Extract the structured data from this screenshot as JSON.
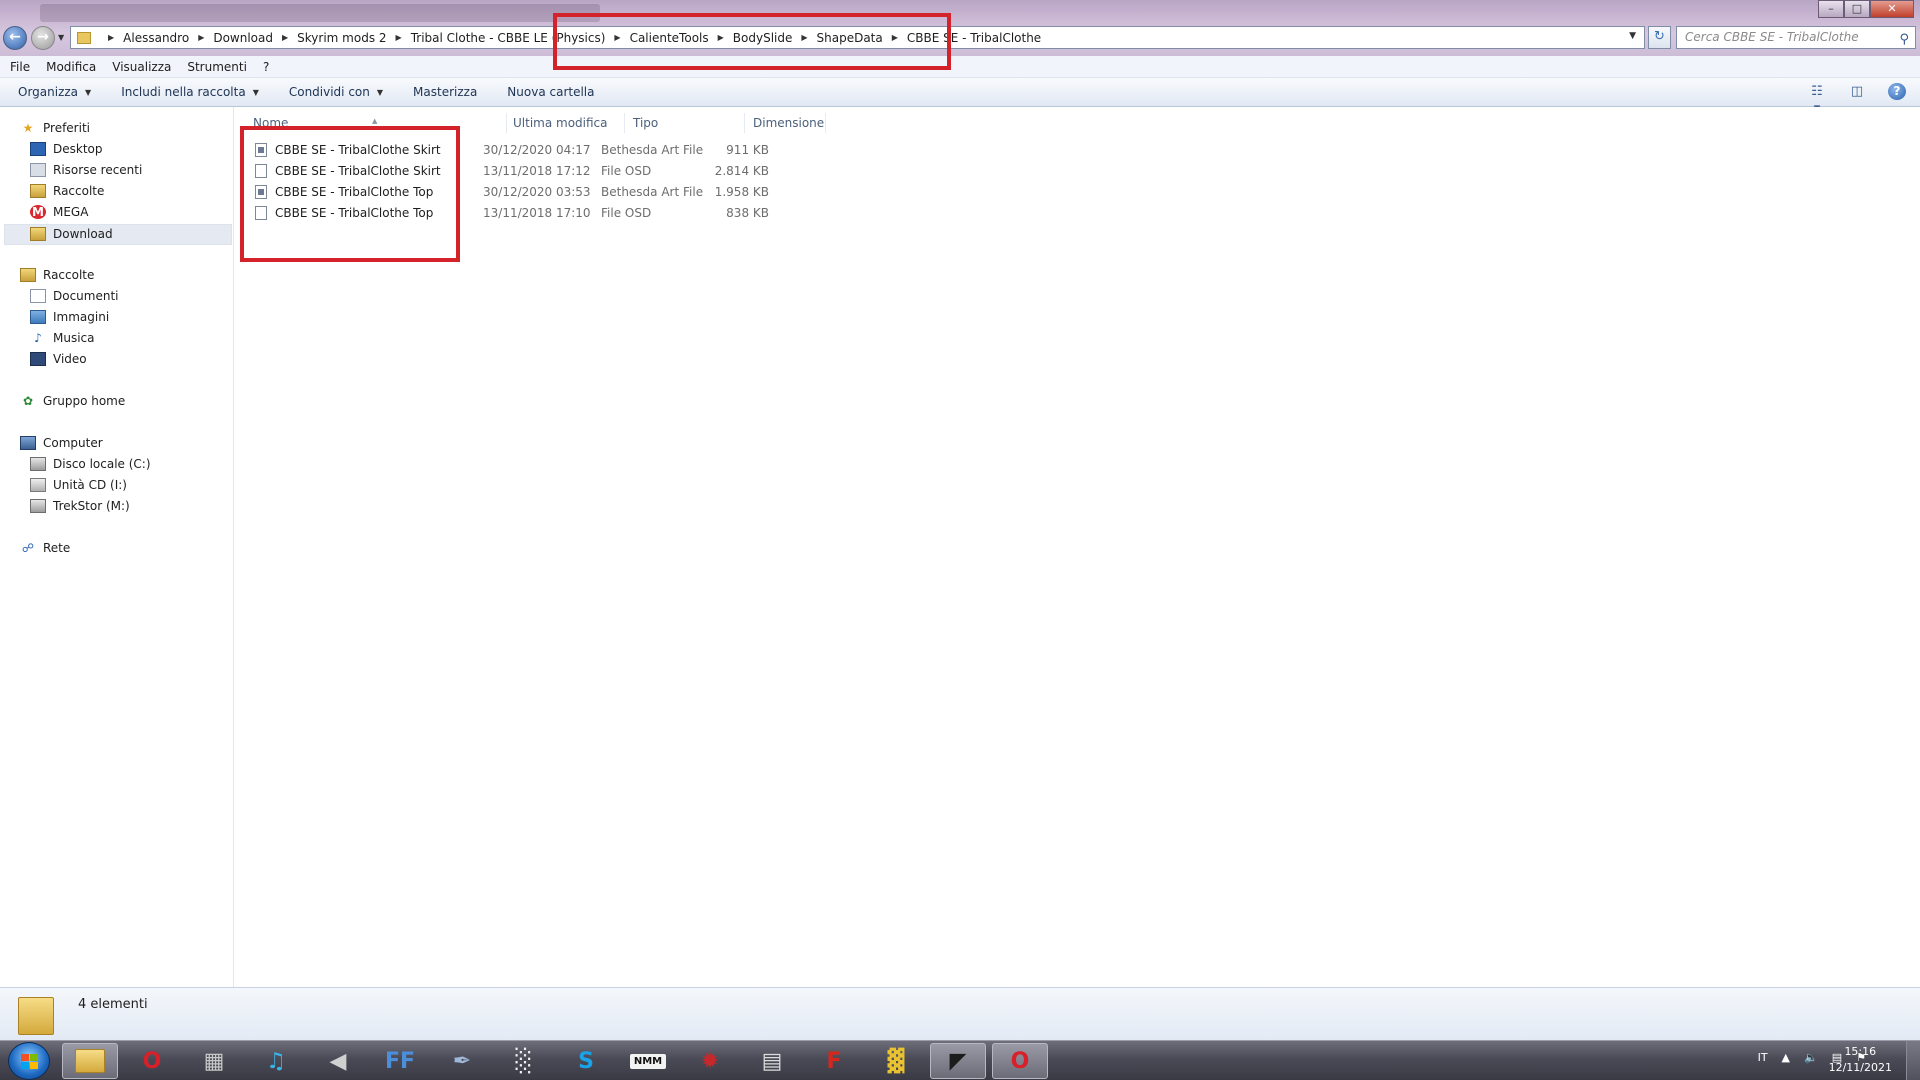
{
  "window": {
    "minimize": "–",
    "maximize": "□",
    "close": "✕"
  },
  "address_bar": {
    "breadcrumbs": [
      "Alessandro",
      "Download",
      "Skyrim mods 2",
      "Tribal Clothe - CBBE LE (Physics)",
      "CalienteTools",
      "BodySlide",
      "ShapeData",
      "CBBE SE - TribalClothe"
    ],
    "search_placeholder": "Cerca CBBE SE - TribalClothe"
  },
  "menu": {
    "items": [
      "File",
      "Modifica",
      "Visualizza",
      "Strumenti",
      "?"
    ]
  },
  "toolbar": {
    "organize": "Organizza",
    "include_in_library": "Includi nella raccolta",
    "share_with": "Condividi con",
    "burn": "Masterizza",
    "new_folder": "Nuova cartella"
  },
  "navigation": {
    "favorites": "Preferiti",
    "desktop": "Desktop",
    "recent": "Risorse recenti",
    "libraries_fav": "Raccolte",
    "mega": "MEGA",
    "download": "Download",
    "libraries": "Raccolte",
    "documents": "Documenti",
    "pictures": "Immagini",
    "music": "Musica",
    "video": "Video",
    "homegroup": "Gruppo home",
    "computer": "Computer",
    "local_disk": "Disco locale (C:)",
    "cd_drive": "Unità CD (I:)",
    "trekstor": "TrekStor (M:)",
    "network": "Rete"
  },
  "columns": {
    "name": "Nome",
    "modified": "Ultima modifica",
    "type": "Tipo",
    "size": "Dimensione"
  },
  "files": [
    {
      "name": "CBBE SE - TribalClothe Skirt",
      "modified": "30/12/2020 04:17",
      "type": "Bethesda Art File",
      "size": "911 KB",
      "icon": "art-file-icon"
    },
    {
      "name": "CBBE SE - TribalClothe Skirt",
      "modified": "13/11/2018 17:12",
      "type": "File OSD",
      "size": "2.814 KB",
      "icon": "file-icon"
    },
    {
      "name": "CBBE SE - TribalClothe Top",
      "modified": "30/12/2020 03:53",
      "type": "Bethesda Art File",
      "size": "1.958 KB",
      "icon": "art-file-icon"
    },
    {
      "name": "CBBE SE - TribalClothe Top",
      "modified": "13/11/2018 17:10",
      "type": "File OSD",
      "size": "838 KB",
      "icon": "file-icon"
    }
  ],
  "status": {
    "item_count": "4 elementi"
  },
  "taskbar": {
    "apps": [
      {
        "name": "explorer",
        "glyph": "",
        "color": "#e2b642",
        "active": true
      },
      {
        "name": "opera",
        "glyph": "O",
        "color": "#d7202a",
        "active": false
      },
      {
        "name": "media-app",
        "glyph": "▦",
        "color": "#c8c8c8",
        "active": false
      },
      {
        "name": "music-app",
        "glyph": "♫",
        "color": "#3ab4e8",
        "active": false
      },
      {
        "name": "audio-app",
        "glyph": "◀",
        "color": "#d0d0d0",
        "active": false
      },
      {
        "name": "ffdec",
        "glyph": "FF",
        "color": "#4b8fdc",
        "active": false
      },
      {
        "name": "quill-app",
        "glyph": "✒",
        "color": "#9fb8d8",
        "active": false
      },
      {
        "name": "utility-app",
        "glyph": "░",
        "color": "#f0f0f0",
        "active": false
      },
      {
        "name": "skype",
        "glyph": "S",
        "color": "#1aa3e8",
        "active": false
      },
      {
        "name": "nmm",
        "glyph": "NMM",
        "color": "#111111",
        "active": false
      },
      {
        "name": "gear-app",
        "glyph": "✹",
        "color": "#c7282b",
        "active": false
      },
      {
        "name": "window-app",
        "glyph": "▤",
        "color": "#dcdcdc",
        "active": false
      },
      {
        "name": "f-app",
        "glyph": "F",
        "color": "#d9261c",
        "active": false
      },
      {
        "name": "chart-app",
        "glyph": "▓",
        "color": "#e8c230",
        "active": false
      },
      {
        "name": "dark-app",
        "glyph": "◤",
        "color": "#1c1c1c",
        "active": true
      },
      {
        "name": "opera-2",
        "glyph": "O",
        "color": "#d7202a",
        "active": true
      }
    ],
    "language": "IT",
    "time": "15:16",
    "date": "12/11/2021"
  }
}
